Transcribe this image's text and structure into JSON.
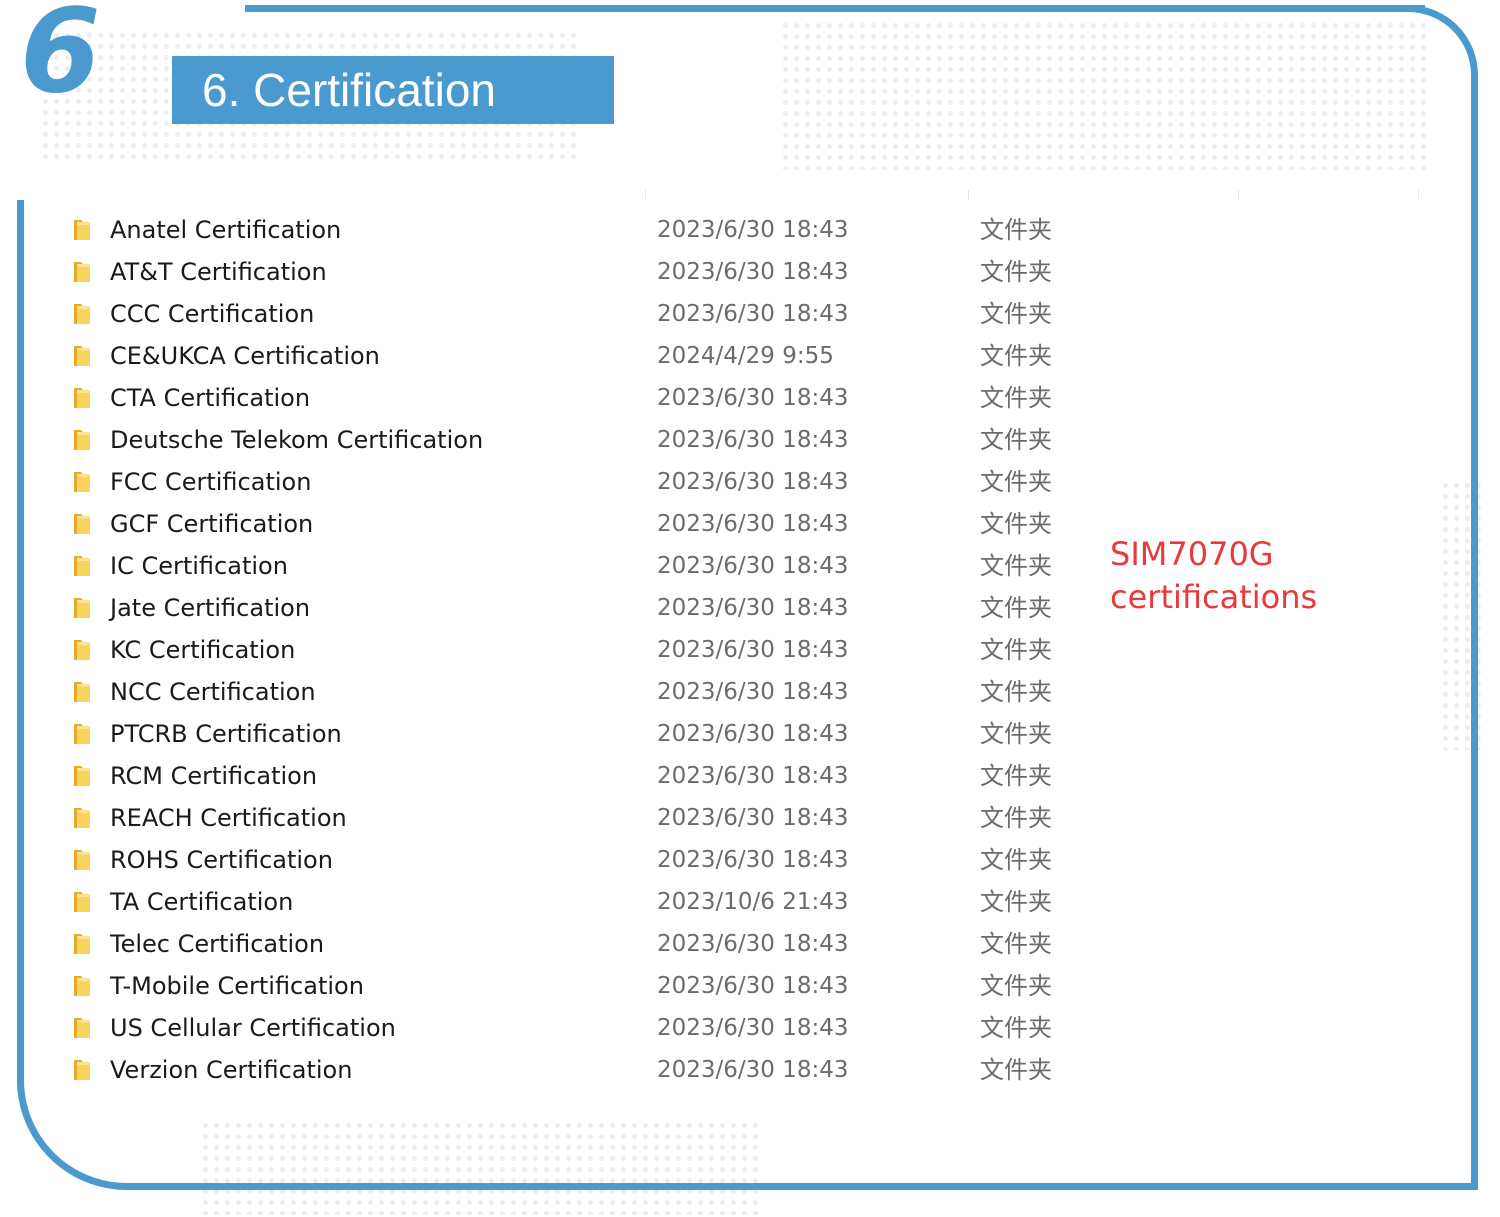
{
  "section": {
    "number": "6",
    "title": "6. Certification"
  },
  "annotation": {
    "line1": "SIM7070G",
    "line2": "certifications"
  },
  "colors": {
    "accent": "#4a9ad0",
    "annotation": "#e83a3a",
    "folder": "#f5c542"
  },
  "icon": "folder-icon",
  "files": [
    {
      "name": "Anatel Certification",
      "date": "2023/6/30 18:43",
      "type": "文件夹"
    },
    {
      "name": "AT&T Certification",
      "date": "2023/6/30 18:43",
      "type": "文件夹"
    },
    {
      "name": "CCC Certification",
      "date": "2023/6/30 18:43",
      "type": "文件夹"
    },
    {
      "name": "CE&UKCA Certification",
      "date": "2024/4/29 9:55",
      "type": "文件夹"
    },
    {
      "name": "CTA Certification",
      "date": "2023/6/30 18:43",
      "type": "文件夹"
    },
    {
      "name": "Deutsche Telekom Certification",
      "date": "2023/6/30 18:43",
      "type": "文件夹"
    },
    {
      "name": "FCC Certification",
      "date": "2023/6/30 18:43",
      "type": "文件夹"
    },
    {
      "name": "GCF Certification",
      "date": "2023/6/30 18:43",
      "type": "文件夹"
    },
    {
      "name": "IC Certification",
      "date": "2023/6/30 18:43",
      "type": "文件夹"
    },
    {
      "name": "Jate Certification",
      "date": "2023/6/30 18:43",
      "type": "文件夹"
    },
    {
      "name": "KC Certification",
      "date": "2023/6/30 18:43",
      "type": "文件夹"
    },
    {
      "name": "NCC Certification",
      "date": "2023/6/30 18:43",
      "type": "文件夹"
    },
    {
      "name": "PTCRB Certification",
      "date": "2023/6/30 18:43",
      "type": "文件夹"
    },
    {
      "name": "RCM Certification",
      "date": "2023/6/30 18:43",
      "type": "文件夹"
    },
    {
      "name": "REACH Certification",
      "date": "2023/6/30 18:43",
      "type": "文件夹"
    },
    {
      "name": "ROHS Certification",
      "date": "2023/6/30 18:43",
      "type": "文件夹"
    },
    {
      "name": "TA Certification",
      "date": "2023/10/6 21:43",
      "type": "文件夹"
    },
    {
      "name": "Telec Certification",
      "date": "2023/6/30 18:43",
      "type": "文件夹"
    },
    {
      "name": "T-Mobile Certification",
      "date": "2023/6/30 18:43",
      "type": "文件夹"
    },
    {
      "name": "US Cellular Certification",
      "date": "2023/6/30 18:43",
      "type": "文件夹"
    },
    {
      "name": "Verzion Certification",
      "date": "2023/6/30 18:43",
      "type": "文件夹"
    }
  ]
}
